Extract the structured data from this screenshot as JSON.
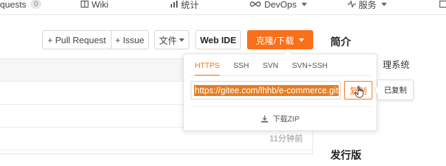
{
  "topnav": {
    "requests_label": "quests",
    "requests_count": "0",
    "wiki_label": "Wiki",
    "stats_label": "统计",
    "devops_label": "DevOps",
    "services_label": "服务"
  },
  "toolbar": {
    "pull_request_label": "+ Pull Request",
    "issue_label": "+ Issue",
    "files_label": "文件",
    "web_ide_label": "Web IDE",
    "clone_label": "克隆/下载"
  },
  "clone_dropdown": {
    "tabs": [
      "HTTPS",
      "SSH",
      "SVN",
      "SVN+SSH"
    ],
    "active_tab": "HTTPS",
    "url_value": "https://gitee.com/lhhb/e-commerce.git",
    "copy_label": "复制",
    "download_label": "下载ZIP"
  },
  "tooltip": {
    "text": "已复制"
  },
  "file_list": {
    "time_label": "11分钟前"
  },
  "sidebar": {
    "intro_title": "简介",
    "intro_partial": "理系统",
    "release_title": "发行版"
  },
  "colors": {
    "accent": "#fa6f1a",
    "selection": "#e67e22"
  }
}
